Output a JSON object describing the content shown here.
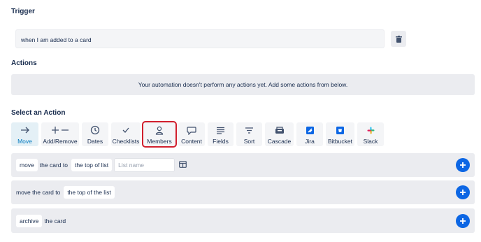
{
  "trigger": {
    "title": "Trigger",
    "value": "when I am added to a card"
  },
  "actions": {
    "title": "Actions",
    "empty_message": "Your automation doesn't perform any actions yet. Add some actions from below."
  },
  "select_action": {
    "title": "Select an Action",
    "tiles": [
      {
        "label": "Move",
        "icon": "arrow-right-icon"
      },
      {
        "label": "Add/Remove",
        "icon": "plus-minus-icon"
      },
      {
        "label": "Dates",
        "icon": "clock-icon"
      },
      {
        "label": "Checklists",
        "icon": "check-icon"
      },
      {
        "label": "Members",
        "icon": "person-icon"
      },
      {
        "label": "Content",
        "icon": "speech-bubble-icon"
      },
      {
        "label": "Fields",
        "icon": "lines-icon"
      },
      {
        "label": "Sort",
        "icon": "sort-icon"
      },
      {
        "label": "Cascade",
        "icon": "cascade-icon"
      },
      {
        "label": "Jira",
        "icon": "jira-icon"
      },
      {
        "label": "Bitbucket",
        "icon": "bitbucket-icon"
      },
      {
        "label": "Slack",
        "icon": "slack-icon"
      }
    ]
  },
  "rules": [
    {
      "parts": [
        "move",
        "the card to",
        "the top of list"
      ],
      "input_placeholder": "List name"
    },
    {
      "parts": [
        "move the card to",
        "the top of the list"
      ]
    },
    {
      "parts": [
        "archive",
        "the card"
      ]
    }
  ],
  "colors": {
    "accent": "#0079bf",
    "highlight": "#d11f2d",
    "add_button": "#0c66e4"
  }
}
